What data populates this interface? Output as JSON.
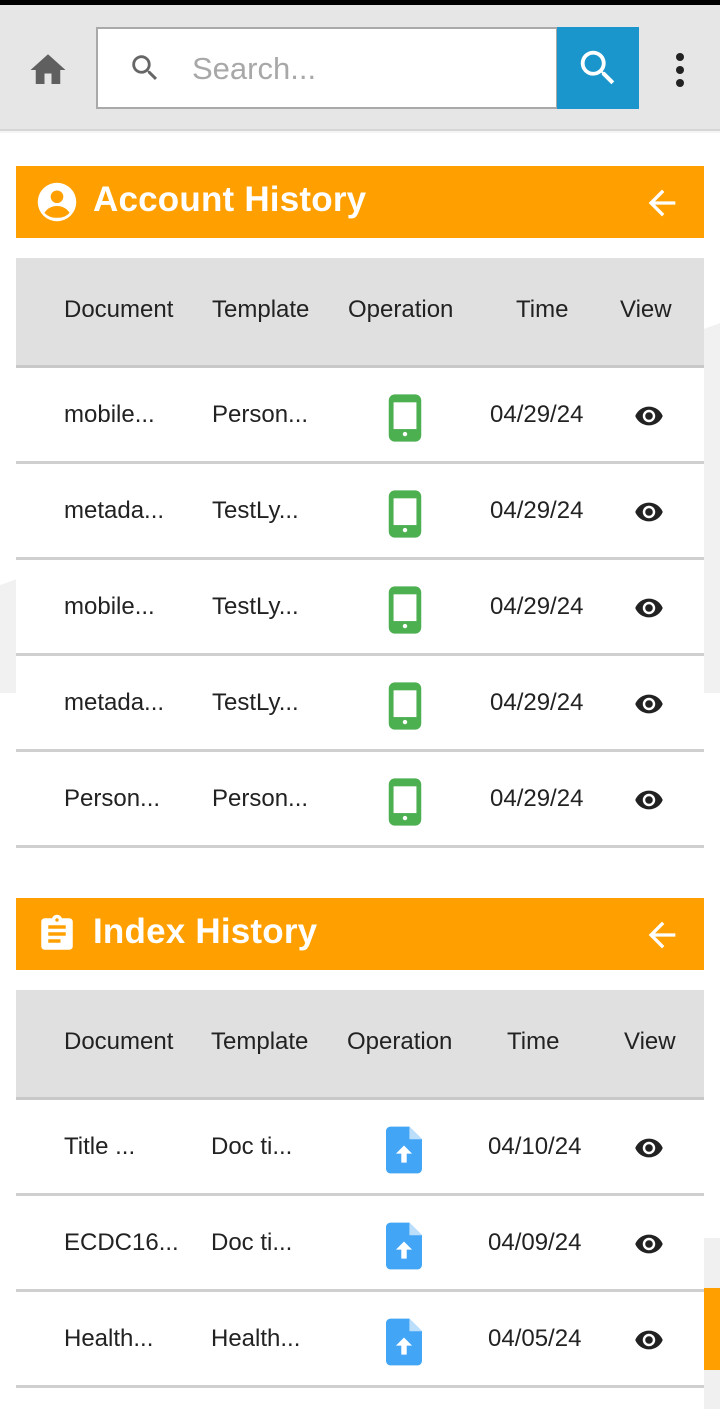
{
  "header": {
    "search_placeholder": "Search..."
  },
  "colors": {
    "accent_orange": "#ffa000",
    "search_button": "#1b96cc",
    "phone_icon": "#4caf50",
    "upload_icon": "#42a5f5"
  },
  "icons": {
    "home": "home-icon",
    "search": "search-icon",
    "more": "more-vert-icon",
    "account": "account-circle-icon",
    "index": "assignment-icon",
    "back": "arrow-back-icon",
    "phone": "phone-android-icon",
    "upload": "file-upload-icon",
    "view": "eye-icon"
  },
  "account_history": {
    "title": "Account History",
    "columns": [
      "Document",
      "Template",
      "Operation",
      "Time",
      "View"
    ],
    "rows": [
      {
        "document": "mobile...",
        "template": "Person...",
        "time": "04/29/24"
      },
      {
        "document": "metada...",
        "template": "TestLy...",
        "time": "04/29/24"
      },
      {
        "document": "mobile...",
        "template": "TestLy...",
        "time": "04/29/24"
      },
      {
        "document": "metada...",
        "template": "TestLy...",
        "time": "04/29/24"
      },
      {
        "document": "Person...",
        "template": "Person...",
        "time": "04/29/24"
      }
    ]
  },
  "index_history": {
    "title": "Index History",
    "columns": [
      "Document",
      "Template",
      "Operation",
      "Time",
      "View"
    ],
    "rows": [
      {
        "document": "Title ...",
        "template": "Doc ti...",
        "time": "04/10/24"
      },
      {
        "document": "ECDC16...",
        "template": "Doc ti...",
        "time": "04/09/24"
      },
      {
        "document": "Health...",
        "template": "Health...",
        "time": "04/05/24"
      }
    ]
  }
}
